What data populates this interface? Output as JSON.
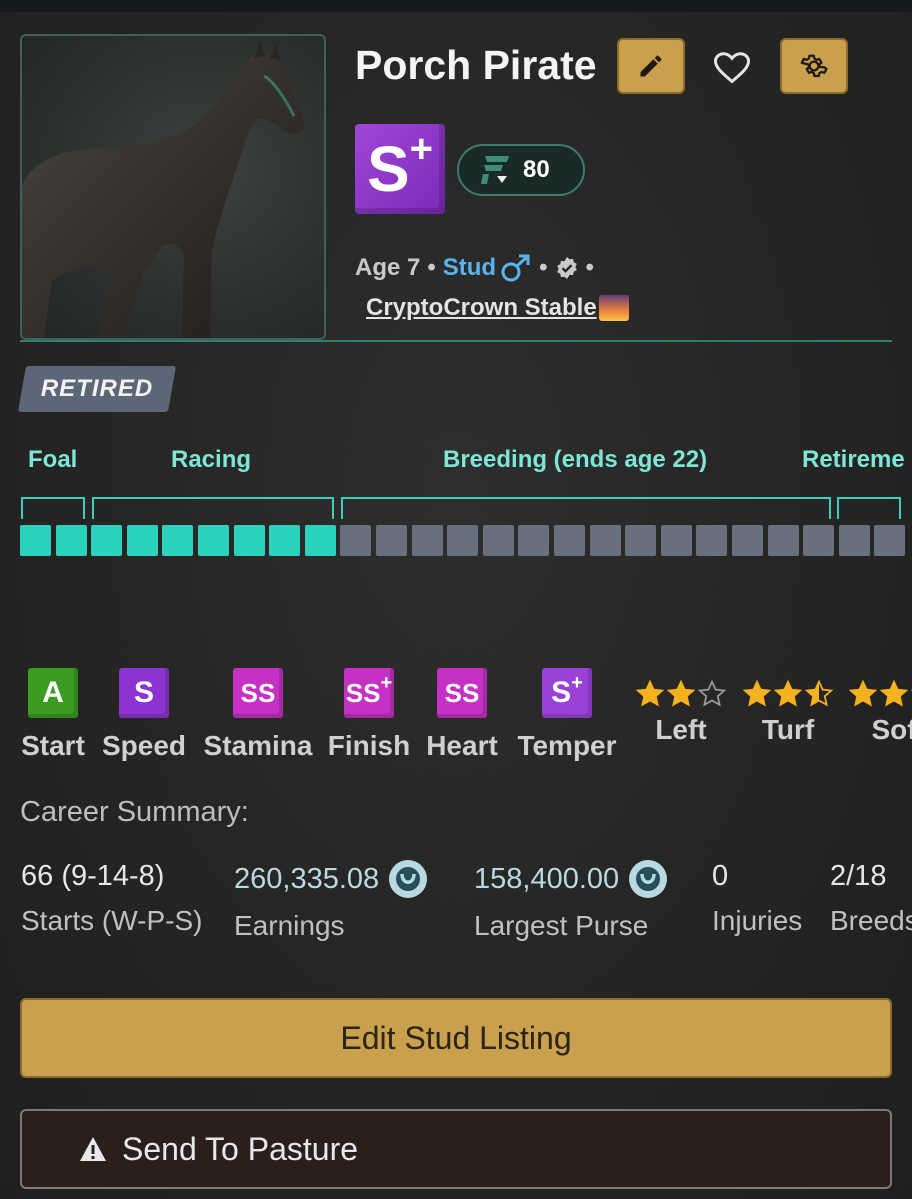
{
  "horse": {
    "name": "Porch Pirate",
    "grade": "S",
    "grade_modifier": "+",
    "rating": "80",
    "age": "Age 7",
    "role": "Stud",
    "stable": "CryptoCrown Stable",
    "status": "RETIRED"
  },
  "lifecycle": {
    "phases": [
      "Foal",
      "Racing",
      "Breeding (ends age 22)",
      "Retireme"
    ],
    "segments_total": 25,
    "segments_filled": 9
  },
  "attributes": [
    {
      "grade": "A",
      "mod": "",
      "label": "Start",
      "color": "#3a9c22"
    },
    {
      "grade": "S",
      "mod": "",
      "label": "Speed",
      "color": "#8c34d0"
    },
    {
      "grade": "SS",
      "mod": "",
      "label": "Stamina",
      "color": "#c431c4"
    },
    {
      "grade": "SS",
      "mod": "+",
      "label": "Finish",
      "color": "#c431c4"
    },
    {
      "grade": "SS",
      "mod": "",
      "label": "Heart",
      "color": "#c431c4"
    },
    {
      "grade": "S",
      "mod": "+",
      "label": "Temper",
      "color": "#9a42d6"
    }
  ],
  "preferences": [
    {
      "label": "Left",
      "stars": 2
    },
    {
      "label": "Turf",
      "stars": 2.5
    },
    {
      "label": "Sof",
      "stars": 2
    }
  ],
  "career": {
    "title": "Career Summary:",
    "stats": [
      {
        "value": "66 (9-14-8)",
        "label": "Starts (W-P-S)"
      },
      {
        "value": "260,335.08",
        "label": "Earnings"
      },
      {
        "value": "158,400.00",
        "label": "Largest Purse"
      },
      {
        "value": "0",
        "label": "Injuries"
      },
      {
        "value": "2/18",
        "label": "Breeds"
      }
    ]
  },
  "actions": {
    "edit_listing": "Edit Stud Listing",
    "send_to_pasture": "Send To Pasture"
  },
  "colors": {
    "accent_gold": "#c9a04e",
    "teal": "#2bd3bf",
    "stud_blue": "#5ab3f0"
  }
}
